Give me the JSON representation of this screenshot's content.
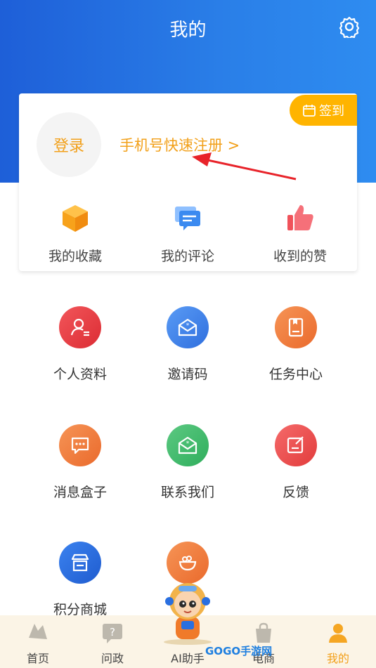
{
  "header": {
    "title": "我的"
  },
  "profile": {
    "login_label": "登录",
    "register_label": "手机号快速注册 >",
    "checkin_label": "签到"
  },
  "quick_actions": [
    {
      "label": "我的收藏",
      "icon": "box-icon"
    },
    {
      "label": "我的评论",
      "icon": "comment-icon"
    },
    {
      "label": "收到的赞",
      "icon": "thumbs-up-icon"
    }
  ],
  "grid": [
    {
      "label": "个人资料",
      "icon": "profile-icon",
      "color": "#ea3a3f"
    },
    {
      "label": "邀请码",
      "icon": "invite-icon",
      "color": "#3b7fe6"
    },
    {
      "label": "任务中心",
      "icon": "task-icon",
      "color": "#f07a3a"
    },
    {
      "label": "消息盒子",
      "icon": "message-icon",
      "color": "#f07a3a"
    },
    {
      "label": "联系我们",
      "icon": "contact-icon",
      "color": "#3cba6a"
    },
    {
      "label": "反馈",
      "icon": "feedback-icon",
      "color": "#ee4c4c"
    },
    {
      "label": "积分商城",
      "icon": "store-icon",
      "color": "#2a6fe0"
    },
    {
      "label": "",
      "icon": "food-bowl-icon",
      "color": "#f07a3a"
    }
  ],
  "tabbar": [
    {
      "label": "首页",
      "icon": "home-icon"
    },
    {
      "label": "问政",
      "icon": "question-icon"
    },
    {
      "label": "AI助手",
      "icon": "ai-assistant-icon"
    },
    {
      "label": "电商",
      "icon": "shopping-bag-icon"
    },
    {
      "label": "我的",
      "icon": "user-icon",
      "active": true
    }
  ],
  "watermark": "GOGO手游网",
  "colors": {
    "accent": "#f2a01a",
    "header_blue": "#2a7fe8",
    "checkin": "#ffb400"
  }
}
